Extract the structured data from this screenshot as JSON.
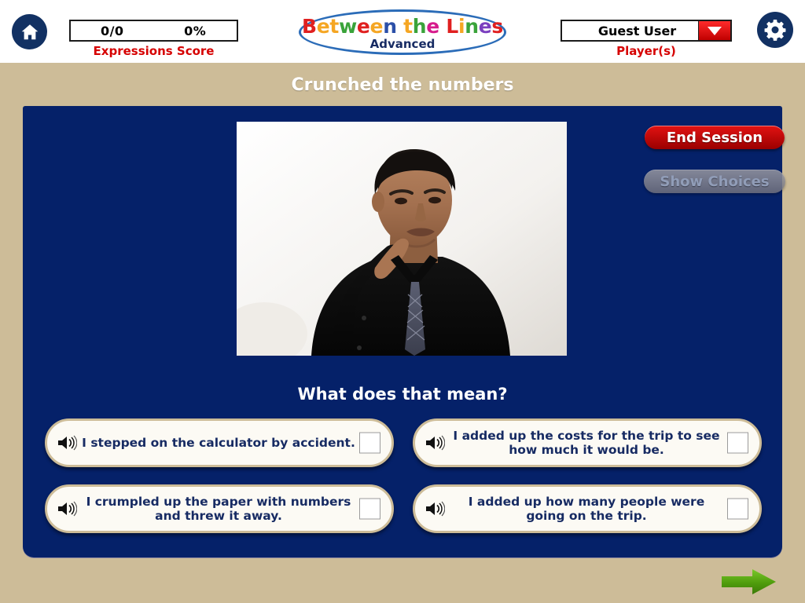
{
  "header": {
    "home_icon": "home-icon",
    "score": {
      "fraction": "0/0",
      "percent": "0%",
      "label": "Expressions Score"
    },
    "logo": {
      "letters": [
        {
          "ch": "B",
          "color": "#e02020"
        },
        {
          "ch": "e",
          "color": "#f5a623"
        },
        {
          "ch": "t",
          "color": "#f5a623"
        },
        {
          "ch": "w",
          "color": "#3aa33a"
        },
        {
          "ch": "e",
          "color": "#e02020"
        },
        {
          "ch": "e",
          "color": "#f5a623"
        },
        {
          "ch": "n",
          "color": "#2b4fa8"
        },
        {
          "ch": " ",
          "color": "#ffffff"
        },
        {
          "ch": "t",
          "color": "#f5a623"
        },
        {
          "ch": "h",
          "color": "#3aa33a"
        },
        {
          "ch": "e",
          "color": "#d61a8c"
        },
        {
          "ch": " ",
          "color": "#ffffff"
        },
        {
          "ch": "L",
          "color": "#e02020"
        },
        {
          "ch": "i",
          "color": "#f5a623"
        },
        {
          "ch": "n",
          "color": "#3aa33a"
        },
        {
          "ch": "e",
          "color": "#7b3fbf"
        },
        {
          "ch": "s",
          "color": "#e02020"
        }
      ],
      "title_text": "Between the Lines",
      "subtitle": "Advanced",
      "ellipse_color": "#2b6cb8"
    },
    "player": {
      "name": "Guest User",
      "label": "Player(s)",
      "dropdown_icon": "chevron-down-icon"
    },
    "gear_icon": "gear-icon"
  },
  "page": {
    "title": "Crunched the numbers",
    "background_color": "#cdbc98",
    "panel_color": "#052169"
  },
  "panel": {
    "end_session_label": "End Session",
    "show_choices_label": "Show Choices",
    "question": "What does that mean?",
    "video": {
      "alt": "man-in-black-shirt-touching-neck"
    }
  },
  "choices": [
    {
      "text": "I stepped on the calculator by accident.",
      "speaker_icon": "speaker-icon",
      "checked": false
    },
    {
      "text": "I added up the costs for the trip to see how much it would be.",
      "speaker_icon": "speaker-icon",
      "checked": false
    },
    {
      "text": "I crumpled up the paper with numbers and threw it away.",
      "speaker_icon": "speaker-icon",
      "checked": false
    },
    {
      "text": "I added up how many people were going on the trip.",
      "speaker_icon": "speaker-icon",
      "checked": false
    }
  ],
  "footer": {
    "next_icon": "arrow-right-icon",
    "next_color": "#56a610"
  }
}
